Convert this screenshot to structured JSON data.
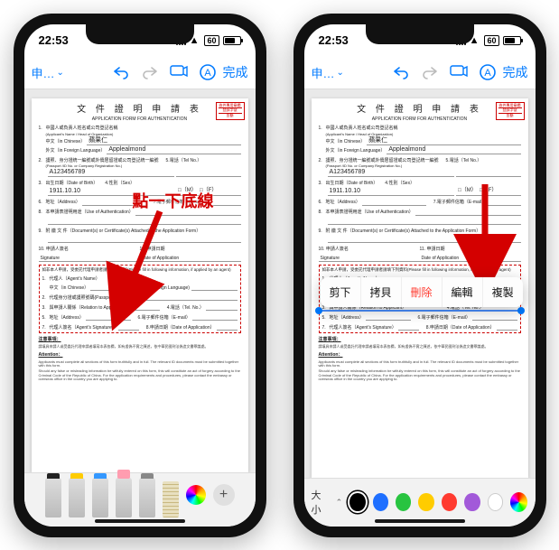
{
  "status": {
    "time": "22:53",
    "battery_pct": 60,
    "battery_label": "60"
  },
  "toolbar": {
    "back_label": "申…",
    "done_label": "完成"
  },
  "doc": {
    "title_zh": "文 件 證 明 申 請 表",
    "title_en": "APPLICATION FORM FOR AUTHENTICATION",
    "stamp_lines": [
      "收件專用章欄",
      "登錄字號",
      "金額"
    ],
    "field1_label": "中國人或負責人姓名或公司登記名稱",
    "field1_sub": "(Applicant's Name / Head of Organization)",
    "field1a_label": "中文（in Chinese）",
    "field1a_value": "蘋果仁",
    "field1b_label": "外文（in Foreign Language）",
    "field1b_value": "Applealmond",
    "field2_label": "護照、身分證統一編號或外僑居留證或公司登記統一編號",
    "field2_sub": "(Passport /ID No.  or Company Registration No.)",
    "field2_value": "A123456789",
    "field3_label": "出生日期（Date of Birth）",
    "field3_value": "1911.10.10",
    "field4_label": "性別（Sex）",
    "field4_m": "□（M）",
    "field4_f": "□（F）",
    "field5_label": "電話（Tel No.）",
    "field6_label": "地址（Address）",
    "field7_label": "電子郵件信箱（E-mail）",
    "field8_label": "本申請表證明用途（Use of Authentication）",
    "field9_label": "附 繳 文 件（Document(s) or Certificate(s) Attached to the Application Form）",
    "field10_label": "申請人簽名",
    "field10_en": "Signature",
    "field11_label": "申請日期",
    "field11_en": "Date of Application",
    "box_head": "如非本人申請，受委託代理申請者請填下列資料(Please fill in following information, if applied by an agent)",
    "box_a": "代理人（Agent's Name）",
    "box_a1": "中文（in Chinese）",
    "box_a2": "外文(in Foreign Language)",
    "box_b": "代理身分證或護照號碼(Passport /ID No.)",
    "box_c": "與申請人關係（Relation to Applicant）",
    "box_d": "電話（Tel. No.）",
    "box_e": "地址（Address）",
    "box_f": "電子郵件信箱（E-mail）",
    "box_g": "代理人簽名（Agent's Signature）",
    "box_h": "申請日期（Date of Application）",
    "attn_label": "注意事項：",
    "attn_en1": "Applicants must complete all sections of this form truthfully and in full. The relevant ID documents must be submitted together with this form.",
    "attn_en2": "Should any false or misleading information be wilfully entered on this form, this will constitute an act of forgery according to the Criminal Code of the Republic of China. For the application requirements and procedures, please contact the embassy or overseas office in the country you are applying to.",
    "attn_label2": "Attention：",
    "attn_zh": "請填具申請人或受委託代理申請者填寫本表各欄，如有虛偽不實之陳述，依中華民國刑法偽造文書罪論處。"
  },
  "annotation": {
    "tap_text": "點一下底線"
  },
  "context_menu": {
    "cut": "剪下",
    "copy": "拷貝",
    "delete": "刪除",
    "edit": "編輯",
    "duplicate": "複製"
  },
  "style_bar": {
    "size_label": "大小"
  },
  "colors": {
    "black": "#000000",
    "blue": "#1e6fff",
    "green": "#28c440",
    "yellow": "#ffcc00",
    "red": "#ff3b30",
    "purple": "#a259d9",
    "white": "#ffffff"
  }
}
